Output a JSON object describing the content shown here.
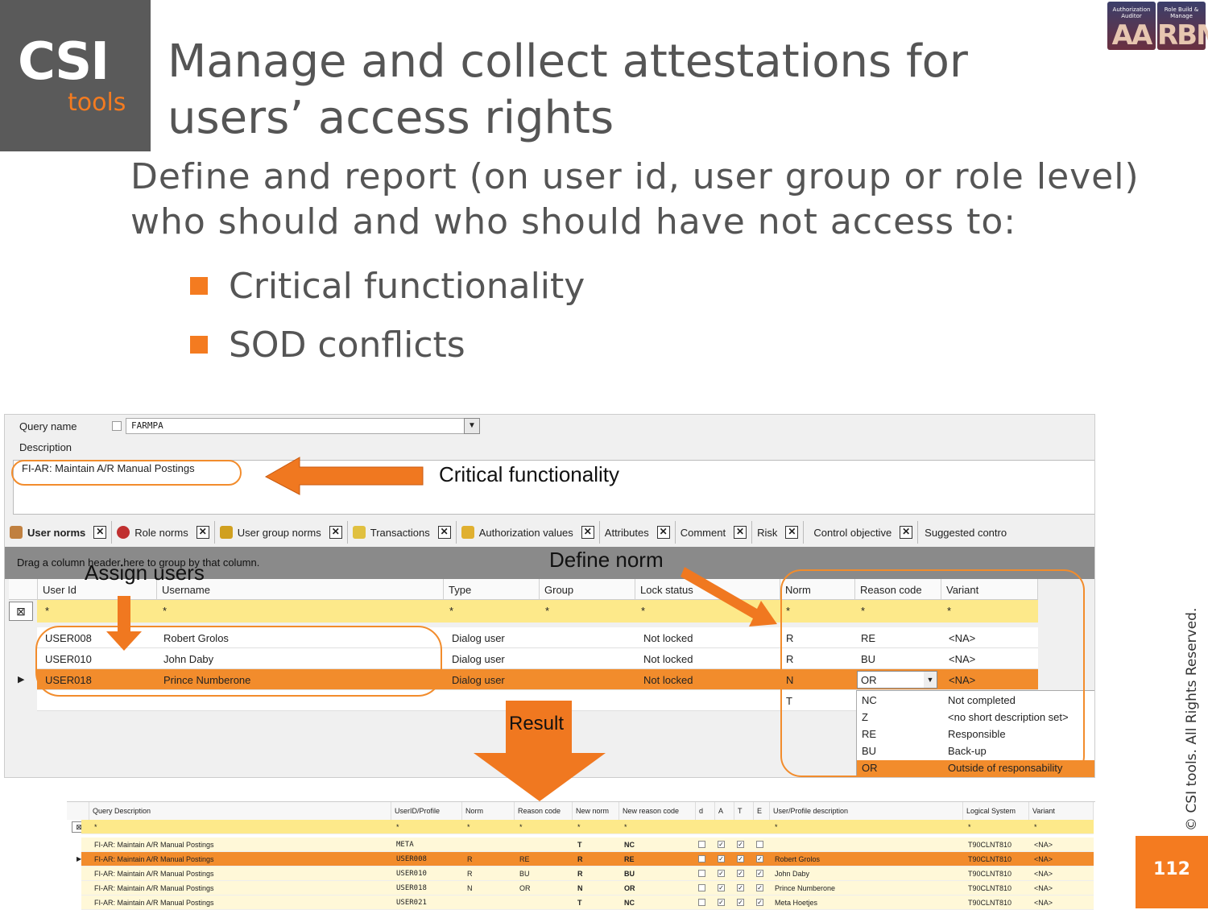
{
  "logo": {
    "csi": "CSI",
    "tools": "tools"
  },
  "title": "Manage and collect attestations for users’ access rights",
  "badges": [
    {
      "small": "Authorization Auditor",
      "big": "AA"
    },
    {
      "small": "Role Build & Manage",
      "big": "RBM"
    }
  ],
  "subtitle": "Define and report (on user id, user group or role level) who should and who should have not access to:",
  "bullets": [
    "Critical functionality",
    "SOD conflicts"
  ],
  "query": {
    "name_label": "Query name",
    "name_value": "FARMPA",
    "description_label": "Description",
    "description_value": "FI-AR: Maintain A/R Manual Postings"
  },
  "tabs": [
    "User norms",
    "Role norms",
    "User group norms",
    "Transactions",
    "Authorization values",
    "Attributes",
    "Comment",
    "Risk",
    "Control objective",
    "Suggested contro"
  ],
  "group_hint": "Drag a column header here to group by that column.",
  "grid": {
    "headers": [
      "User Id",
      "Username",
      "Type",
      "Group",
      "Lock status",
      "Norm",
      "Reason code",
      "Variant"
    ],
    "filter": "*",
    "rows": [
      {
        "user_id": "USER008",
        "username": "Robert Grolos",
        "type": "Dialog user",
        "group": "",
        "lock": "Not locked",
        "norm": "R",
        "reason": "RE",
        "variant": "<NA>"
      },
      {
        "user_id": "USER010",
        "username": "John Daby",
        "type": "Dialog user",
        "group": "",
        "lock": "Not locked",
        "norm": "R",
        "reason": "BU",
        "variant": "<NA>"
      },
      {
        "user_id": "USER018",
        "username": "Prince Numberone",
        "type": "Dialog user",
        "group": "",
        "lock": "Not locked",
        "norm": "N",
        "reason": "OR",
        "variant": "<NA>"
      },
      {
        "user_id": "",
        "username": "",
        "type": "",
        "group": "",
        "lock": "",
        "norm": "T",
        "reason": "",
        "variant": ""
      }
    ],
    "dropdown": [
      {
        "code": "NC",
        "desc": "Not completed"
      },
      {
        "code": "Z",
        "desc": "<no short description set>"
      },
      {
        "code": "RE",
        "desc": "Responsible"
      },
      {
        "code": "BU",
        "desc": "Back-up"
      },
      {
        "code": "OR",
        "desc": "Outside of responsability"
      }
    ]
  },
  "callouts": {
    "critical": "Critical functionality",
    "define_norm": "Define norm",
    "assign_users": "Assign users",
    "result": "Result"
  },
  "result": {
    "headers": [
      "Query Description",
      "UserID/Profile",
      "Norm",
      "Reason code",
      "New norm",
      "New reason code",
      "d",
      "A",
      "T",
      "E",
      "User/Profile description",
      "Logical System",
      "Variant"
    ],
    "filter": "*",
    "rows": [
      {
        "desc": "FI-AR: Maintain A/R Manual Postings",
        "uid": "META",
        "norm": "",
        "reason": "",
        "new_norm": "T",
        "new_reason": "NC",
        "d": false,
        "a": true,
        "t": true,
        "e": false,
        "udesc": "",
        "sys": "T90CLNT810",
        "variant": "<NA>"
      },
      {
        "desc": "FI-AR: Maintain A/R Manual Postings",
        "uid": "USER008",
        "norm": "R",
        "reason": "RE",
        "new_norm": "R",
        "new_reason": "RE",
        "d": false,
        "a": true,
        "t": true,
        "e": true,
        "udesc": "Robert Grolos",
        "sys": "T90CLNT810",
        "variant": "<NA>"
      },
      {
        "desc": "FI-AR: Maintain A/R Manual Postings",
        "uid": "USER010",
        "norm": "R",
        "reason": "BU",
        "new_norm": "R",
        "new_reason": "BU",
        "d": false,
        "a": true,
        "t": true,
        "e": true,
        "udesc": "John Daby",
        "sys": "T90CLNT810",
        "variant": "<NA>"
      },
      {
        "desc": "FI-AR: Maintain A/R Manual Postings",
        "uid": "USER018",
        "norm": "N",
        "reason": "OR",
        "new_norm": "N",
        "new_reason": "OR",
        "d": false,
        "a": true,
        "t": true,
        "e": true,
        "udesc": "Prince Numberone",
        "sys": "T90CLNT810",
        "variant": "<NA>"
      },
      {
        "desc": "FI-AR: Maintain A/R Manual Postings",
        "uid": "USER021",
        "norm": "",
        "reason": "",
        "new_norm": "T",
        "new_reason": "NC",
        "d": false,
        "a": true,
        "t": true,
        "e": true,
        "udesc": "Meta Hoetjes",
        "sys": "T90CLNT810",
        "variant": "<NA>"
      }
    ]
  },
  "copyright": "© CSI tools. All Rights Reserved.",
  "page_number": "112",
  "colors": {
    "accent": "#f47b20",
    "selection": "#f28c2c",
    "filter_row": "#fde98a"
  }
}
